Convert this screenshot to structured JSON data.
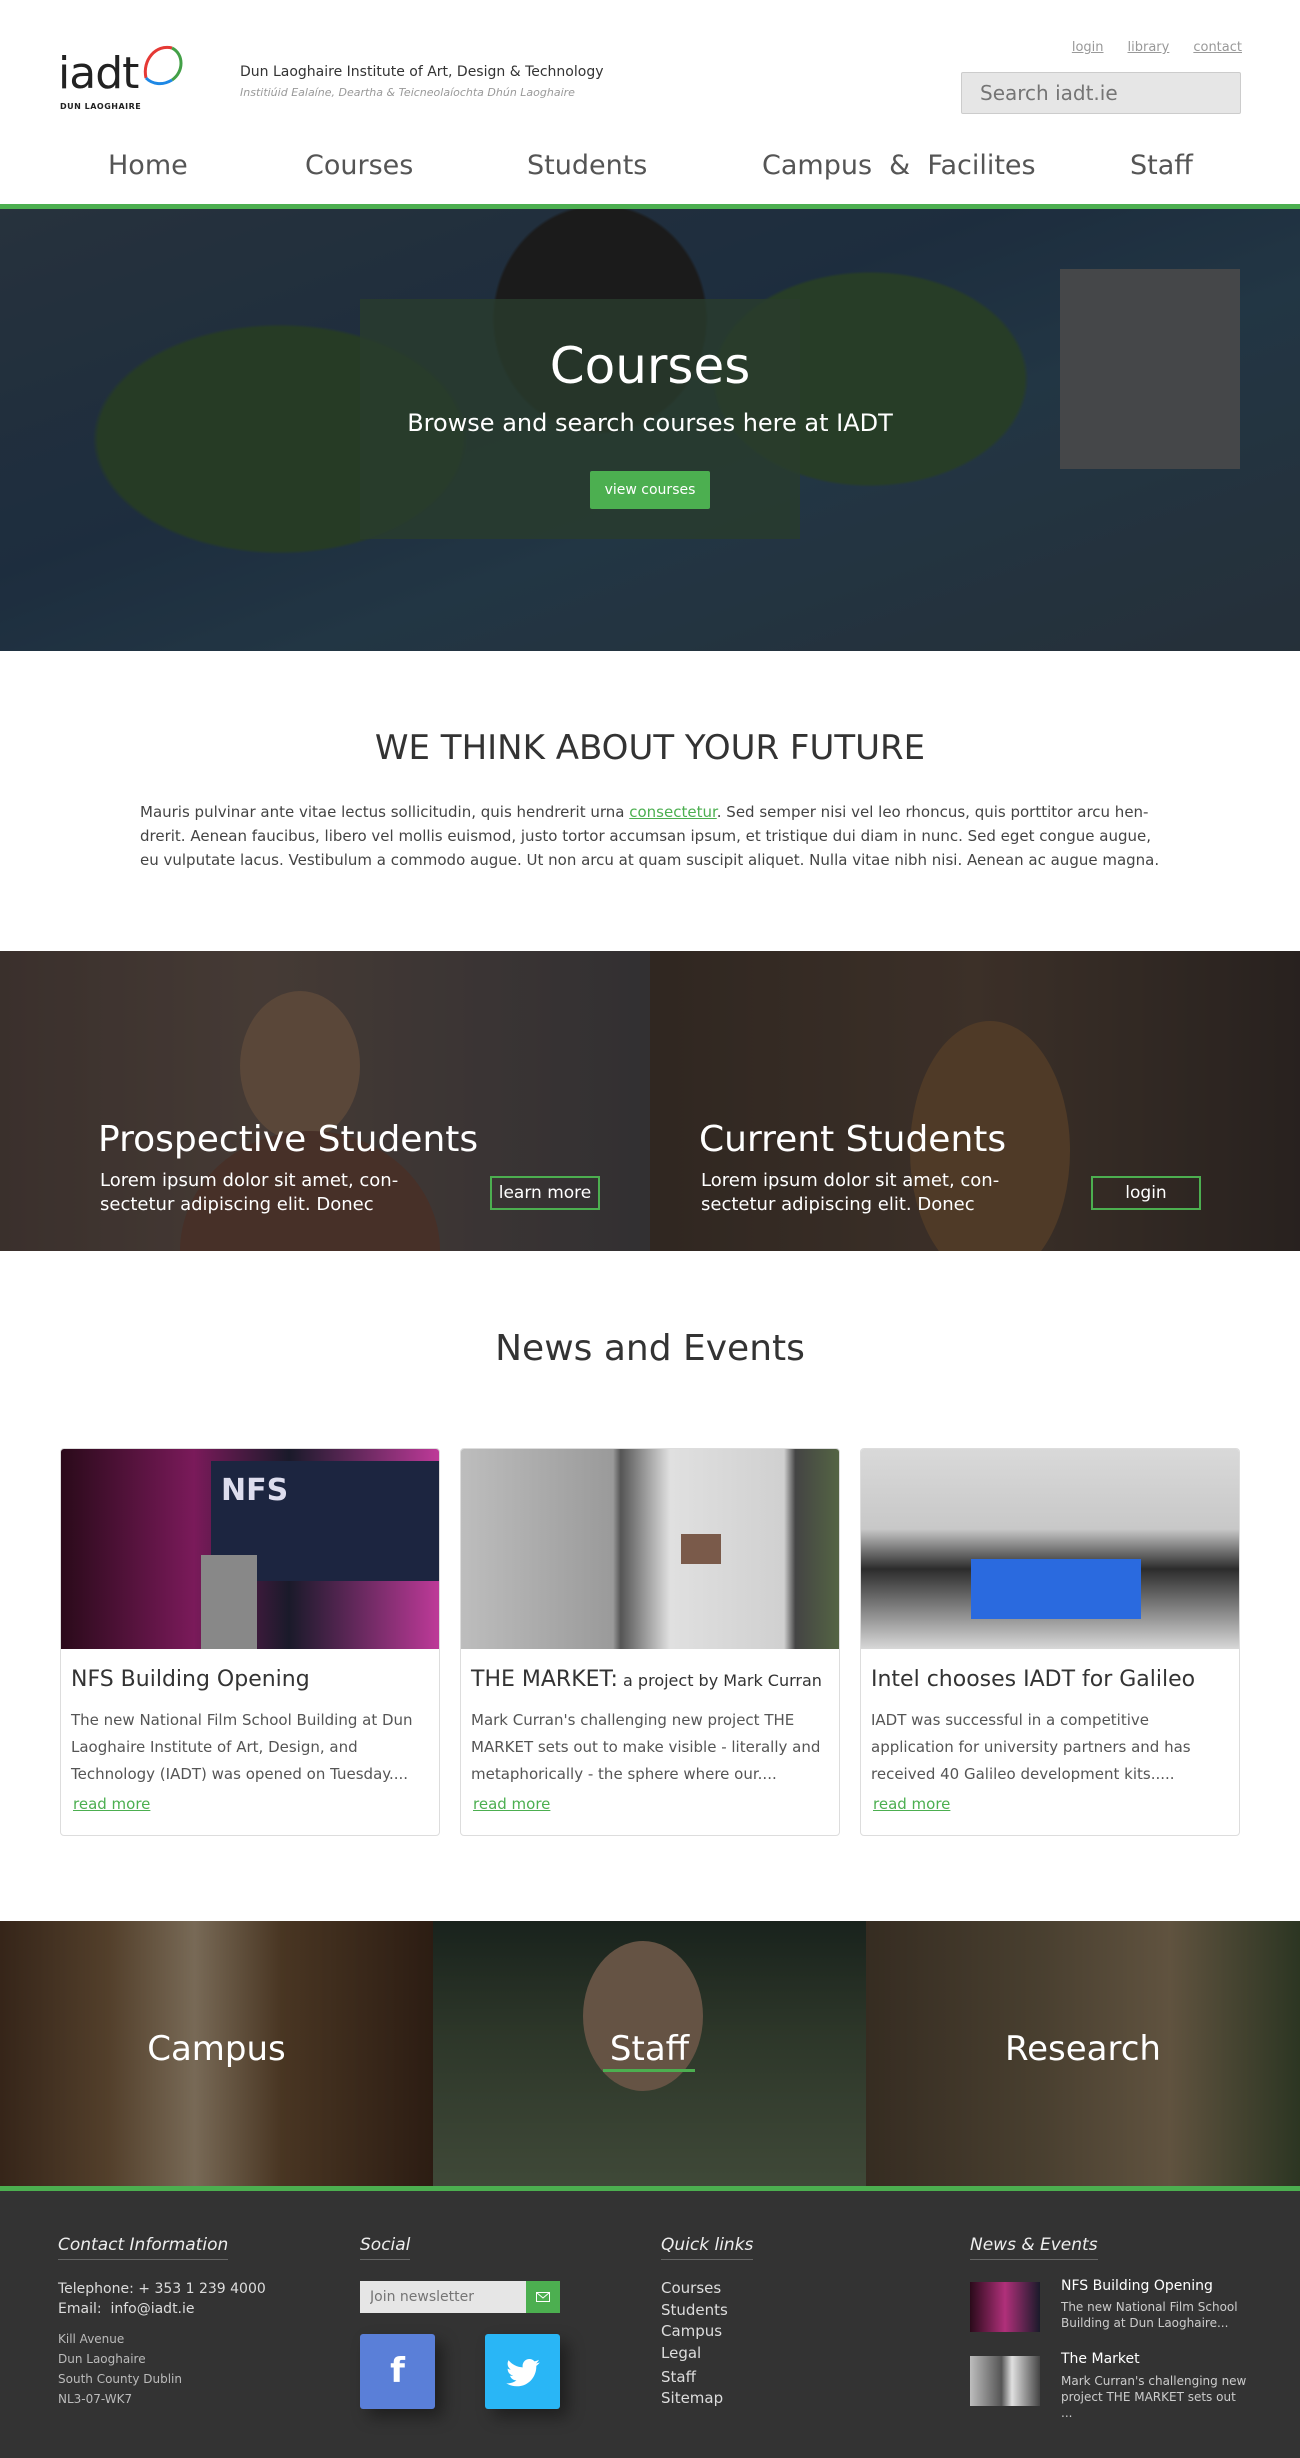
{
  "header": {
    "logo_text": "iadt",
    "logo_sub": "DUN LAOGHAIRE",
    "institute_name": "Dun Laoghaire Institute of Art, Design & Technology",
    "institute_irish": "Institiúid Ealaíne, Deartha & Teicneolaíochta Dhún Laoghaire",
    "top_links": [
      "login",
      "library",
      "contact"
    ],
    "search_placeholder": "Search iadt.ie",
    "nav": [
      "Home",
      "Courses",
      "Students",
      "Campus  &  Facilites",
      "Staff"
    ],
    "accent_color": "#4caf50"
  },
  "hero": {
    "title": "Courses",
    "subtitle": "Browse and search courses here at IADT",
    "button": "view courses"
  },
  "future": {
    "title": "WE THINK ABOUT YOUR FUTURE",
    "text_before_link": "Mauris pulvinar ante vitae lectus sollicitudin, quis hendrerit urna ",
    "link": "consectetur",
    "text_after_link": ". Sed semper nisi vel leo rhoncus, quis porttitor arcu hen-drerit. Aenean faucibus, libero vel mollis euismod, justo tortor accumsan ipsum, et tristique dui diam in nunc. Sed eget congue augue, eu vulputate lacus. Vestibulum a commodo augue. Ut non arcu at quam suscipit aliquet. Nulla vitae nibh nisi. Aenean ac augue magna."
  },
  "students": [
    {
      "title": "Prospective Students",
      "text": "Lorem ipsum dolor sit amet, con-sectetur adipiscing elit. Donec",
      "button": "learn more"
    },
    {
      "title": "Current Students",
      "text": "Lorem ipsum dolor sit amet, con-sectetur adipiscing elit. Donec",
      "button": "login"
    }
  ],
  "news": {
    "title": "News and Events",
    "cards": [
      {
        "heading": "NFS Building Opening",
        "heading_small": "",
        "body": "The new National Film School Building at Dun Laoghaire Institute of Art, Design, and Technology (IADT) was opened on Tuesday....",
        "read_more": "read more",
        "img_text": "NFS"
      },
      {
        "heading": "THE MARKET:",
        "heading_small": " a project by Mark Curran",
        "body": "Mark Curran's challenging new project THE MARKET sets out to make visible - literally and metaphorically - the sphere where our....",
        "read_more": "read more"
      },
      {
        "heading": "Intel chooses IADT for Galileo",
        "heading_small": "",
        "body": "IADT was successful in a competitive application for university partners and has received 40 Galileo development kits.....",
        "read_more": "read more"
      }
    ]
  },
  "triptych": [
    "Campus",
    "Staff",
    "Research"
  ],
  "footer": {
    "contact": {
      "heading": "Contact Information",
      "telephone": "Telephone: + 353 1 239 4000",
      "email": "Email:  info@iadt.ie",
      "address": [
        "Kill Avenue",
        "Dun Laoghaire",
        "South County Dublin",
        "NL3-07-WK7"
      ]
    },
    "social": {
      "heading": "Social",
      "newsletter_placeholder": "Join newsletter",
      "facebook": "f",
      "twitter_icon": "twitter-icon"
    },
    "quick_links": {
      "heading": "Quick links",
      "items": [
        "Courses",
        "Students",
        "Campus",
        "Legal",
        "Staff",
        "Sitemap"
      ]
    },
    "news_events": {
      "heading": "News & Events",
      "items": [
        {
          "title": "NFS Building Opening",
          "text": "The new National Film School Building at Dun Laoghaire..."
        },
        {
          "title": "The Market",
          "text": "Mark Curran's challenging new project THE MARKET sets out ..."
        }
      ]
    }
  }
}
